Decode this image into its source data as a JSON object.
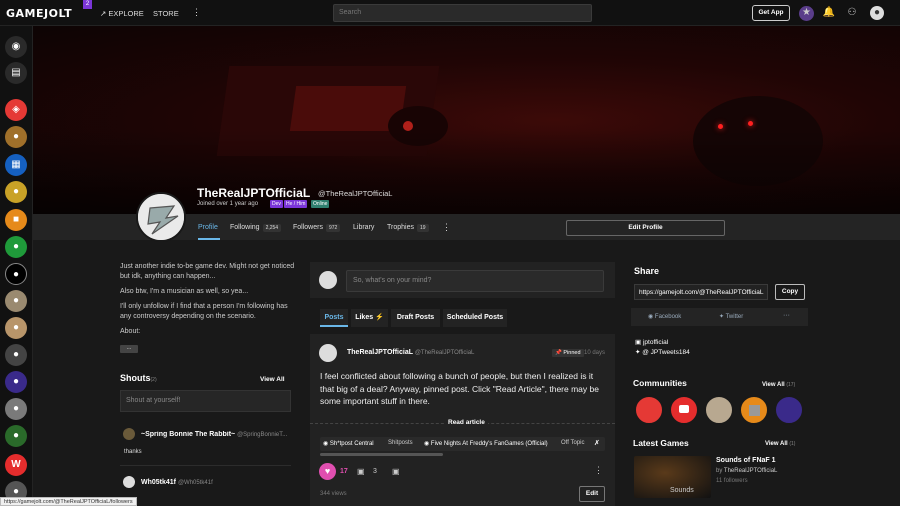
{
  "topbar": {
    "logo": "GAMEJOLT",
    "logo_badge": "2",
    "explore": "EXPLORE",
    "store": "STORE",
    "search_placeholder": "Search",
    "get_app": "Get App"
  },
  "profile": {
    "name": "TheRealJPTOfficiaL",
    "handle": "@TheRealJPTOfficiaL",
    "joined": "Joined over 1 year ago",
    "tags": [
      "Dev",
      "He / Him",
      "Online"
    ],
    "tabs": [
      {
        "label": "Profile",
        "count": ""
      },
      {
        "label": "Following",
        "count": "2,254"
      },
      {
        "label": "Followers",
        "count": "972"
      },
      {
        "label": "Library",
        "count": ""
      },
      {
        "label": "Trophies",
        "count": "19"
      }
    ],
    "edit_label": "Edit Profile"
  },
  "about": {
    "lines": [
      "Just another indie to-be game dev. Might not get noticed but idk, anything can happen...",
      "Also btw, I'm a musician as well, so yea...",
      "I'll only unfollow if I find that a person I'm following has any controversy depending on the scenario.",
      "About:"
    ],
    "more_label": "..."
  },
  "shouts": {
    "title": "Shouts",
    "count": "(2)",
    "view_all": "View All",
    "placeholder": "Shout at yourself!",
    "items": [
      {
        "author": "~Spring Bonnie The Rabbit~",
        "handle": "@SpringBonnieT...",
        "text": "thanks"
      },
      {
        "author": "Wh05tk41f",
        "handle": "@Wh05tk41f",
        "text": ""
      }
    ]
  },
  "feed": {
    "compose_placeholder": "So, what's on your mind?",
    "tabs": [
      "Posts",
      "Likes",
      "Draft Posts",
      "Scheduled Posts"
    ],
    "post": {
      "author": "TheRealJPTOfficiaL",
      "handle": "@TheRealJPTOfficiaL",
      "pinned": "Pinned",
      "time": "10 days",
      "body": "I feel conflicted about following a bunch of people, but then I realized is it that big of a deal? Anyway, pinned post. Click \"Read Article\", there may be some important stuff in there.",
      "read_article": "Read article",
      "communities": [
        "Sh*tpost Central",
        "Shitposts",
        "Five Nights At Freddy's FanGames (Official)",
        "Off Topic"
      ],
      "likes": "17",
      "comments": "3",
      "views": "344 views",
      "edit": "Edit"
    }
  },
  "share": {
    "title": "Share",
    "url": "https://gamejolt.com/@TheRealJPTOfficiaL",
    "copy": "Copy",
    "facebook": "Facebook",
    "twitter": "Twitter",
    "more": "···"
  },
  "links": {
    "twitch": "jptofficial",
    "twitter": "@ JPTweets184"
  },
  "communities": {
    "title": "Communities",
    "view_all": "View All",
    "count": "(17)"
  },
  "games": {
    "title": "Latest Games",
    "view_all": "View All",
    "count": "(1)",
    "game_title": "Sounds of FNaF 1",
    "game_by": "by",
    "game_dev": "TheRealJPTOfficiaL",
    "game_followers": "11 followers",
    "thumb_text": "Sounds"
  },
  "status_url": "https://gamejolt.com/@TheRealJPTOfficiaL/followers",
  "colors": {
    "accent_purple": "#7b35d8",
    "accent_green": "#2f7f6f",
    "like_pink": "#e04fb0",
    "banner_red": "#3c0a08"
  }
}
